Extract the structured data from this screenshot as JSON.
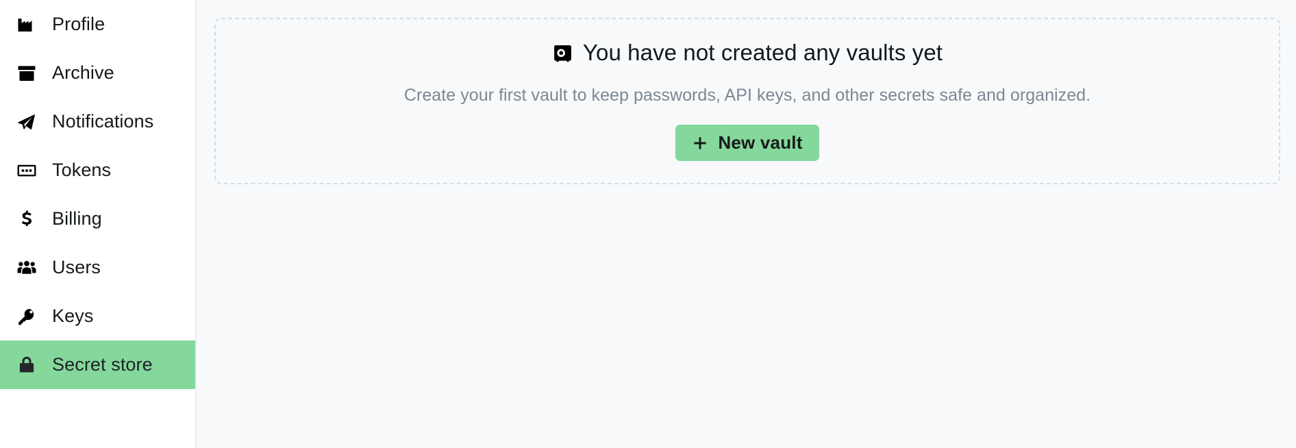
{
  "sidebar": {
    "items": [
      {
        "label": "Profile",
        "icon": "factory-icon",
        "active": false
      },
      {
        "label": "Archive",
        "icon": "archive-box-icon",
        "active": false
      },
      {
        "label": "Notifications",
        "icon": "paper-plane-icon",
        "active": false
      },
      {
        "label": "Tokens",
        "icon": "token-dots-icon",
        "active": false
      },
      {
        "label": "Billing",
        "icon": "dollar-sign-icon",
        "active": false
      },
      {
        "label": "Users",
        "icon": "users-group-icon",
        "active": false
      },
      {
        "label": "Keys",
        "icon": "key-icon",
        "active": false
      },
      {
        "label": "Secret store",
        "icon": "lock-icon",
        "active": true
      }
    ],
    "active_index": 7
  },
  "main": {
    "empty_state": {
      "icon": "vault-safe-icon",
      "title": "You have not created any vaults yet",
      "subtitle": "Create your first vault to keep passwords, API keys, and other secrets safe and organized.",
      "button": {
        "icon": "plus-icon",
        "label": "New vault"
      }
    }
  },
  "colors": {
    "accent_green": "#85d89b",
    "page_background": "#f7f9fb",
    "sidebar_background": "#ffffff",
    "dashed_border": "#cfdfe8",
    "muted_text": "#7b8793",
    "primary_text": "#14181b"
  }
}
